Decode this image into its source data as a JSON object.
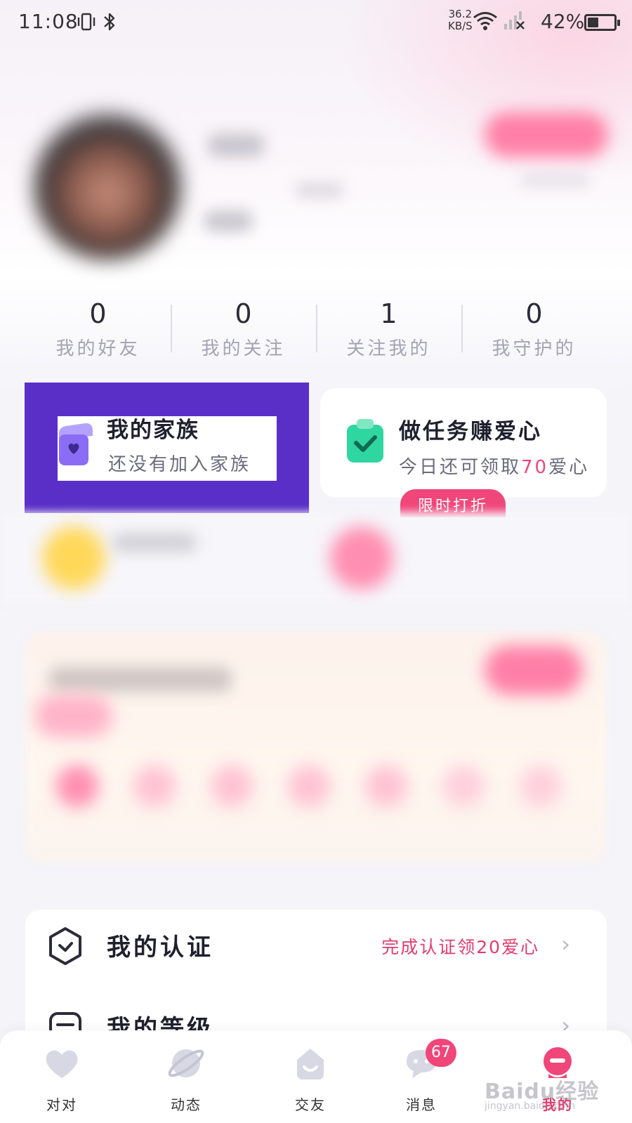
{
  "status_bar": {
    "time": "11:08",
    "net_speed_value": "36.2",
    "net_speed_unit": "KB/S",
    "battery": "42%",
    "battery_level": 0.42
  },
  "stats": [
    {
      "value": "0",
      "label": "我的好友"
    },
    {
      "value": "0",
      "label": "我的关注"
    },
    {
      "value": "1",
      "label": "关注我的"
    },
    {
      "value": "0",
      "label": "我守护的"
    }
  ],
  "family_card": {
    "title": "我的家族",
    "subtitle": "还没有加入家族",
    "highlight_color": "#5a2fc8"
  },
  "task_card": {
    "title": "做任务赚爱心",
    "subtitle_prefix": "今日还可领取",
    "subtitle_amount": "70",
    "subtitle_suffix": "爱心",
    "pill_label": "限时打折"
  },
  "list": {
    "certification": {
      "title": "我的认证",
      "value": "完成认证领20爱心"
    },
    "level": {
      "title": "我的等级"
    }
  },
  "tab_bar": {
    "tabs": [
      {
        "label": "对对",
        "icon": "heart-icon"
      },
      {
        "label": "动态",
        "icon": "planet-icon"
      },
      {
        "label": "交友",
        "icon": "smile-icon"
      },
      {
        "label": "消息",
        "icon": "chat-icon",
        "badge": "67"
      },
      {
        "label": "我的",
        "icon": "profile-icon",
        "active": true
      }
    ]
  },
  "watermark": {
    "main": "Baidu经验",
    "sub": "jingyan.baidu.com"
  },
  "colors": {
    "accent": "#f0467a",
    "highlight": "#5a2fc8",
    "task_green": "#2fd6a0"
  }
}
